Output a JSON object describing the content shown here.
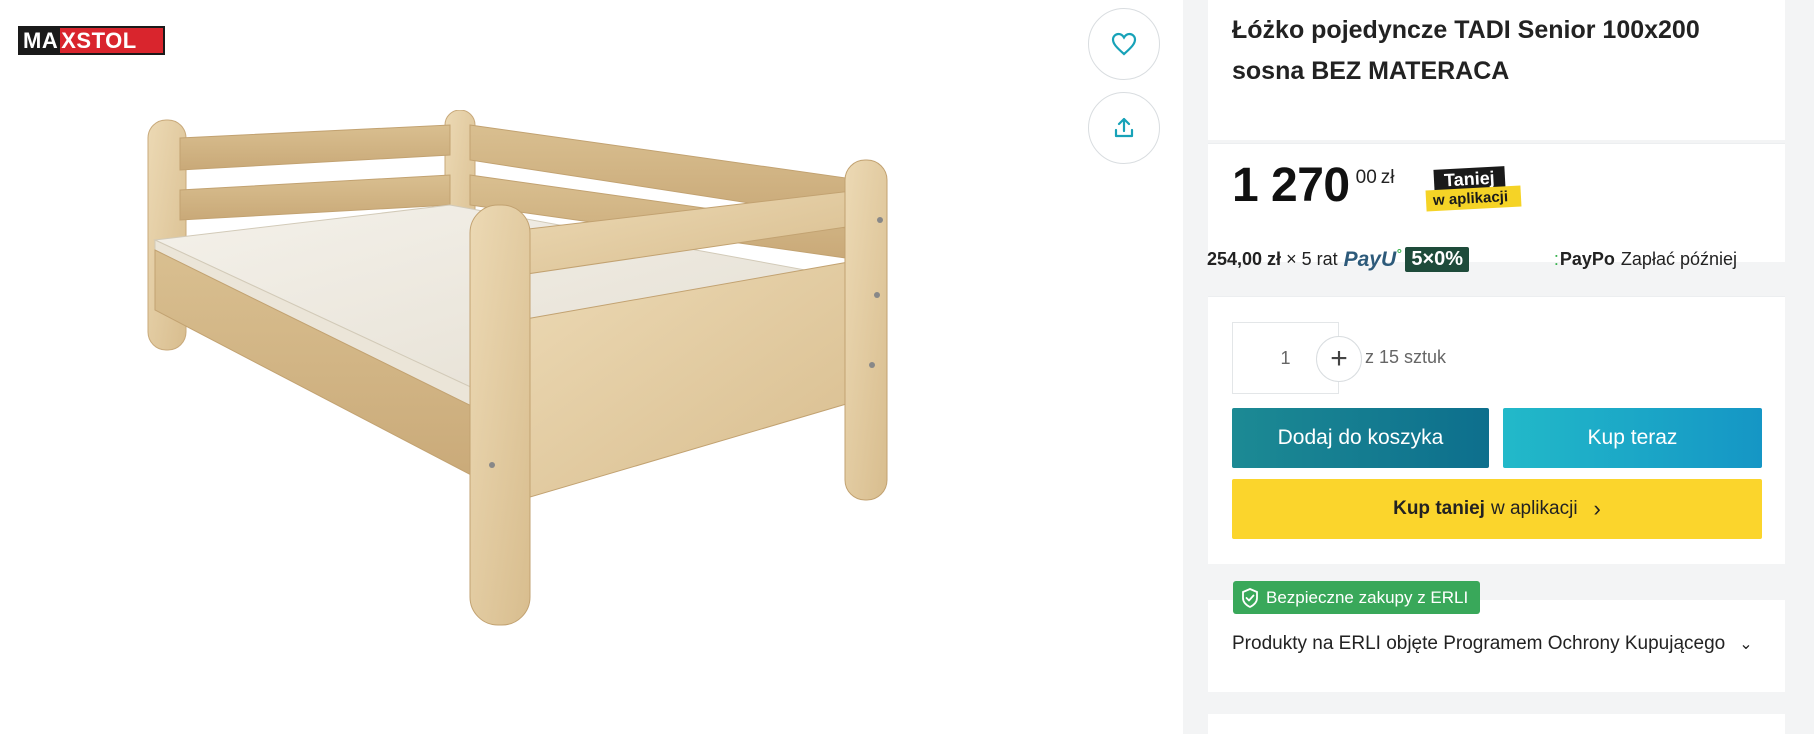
{
  "logo": {
    "part1": "MA",
    "part2": "XSTOL"
  },
  "gallery": {
    "favorite_icon": "heart-icon",
    "share_icon": "share-icon"
  },
  "product": {
    "title_line1": "Łóżko pojedyncze TADI Senior 100x200",
    "title_line2": "sosna BEZ MATERACA"
  },
  "price": {
    "integer": "1 270",
    "decimal": "00",
    "currency": "zł"
  },
  "app_badge": {
    "line1": "Taniej",
    "line2": "w aplikacji"
  },
  "installments": {
    "amount": "254,00 zł",
    "times": "×",
    "count": "5 rat",
    "payu_label": "PayU",
    "promo": "5×0%",
    "paypo_label": "PayPo",
    "paypo_text": "Zapłać później"
  },
  "quantity": {
    "value": "1",
    "plus": "+",
    "stock": "z 15 sztuk"
  },
  "buttons": {
    "add_to_cart": "Dodaj do koszyka",
    "buy_now": "Kup teraz",
    "app_bold": "Kup taniej",
    "app_rest": "w aplikacji",
    "app_chevron": "›"
  },
  "safety": {
    "badge": "Bezpieczne zakupy z ERLI",
    "text": "Produkty na ERLI objęte Programem Ochrony Kupującego",
    "chevron": "⌄"
  },
  "colors": {
    "accent_teal": "#0d6f8d",
    "accent_cyan": "#22b9c9",
    "yellow": "#fbd52c",
    "green": "#39a85a",
    "payu_green_bg": "#1e4b3a",
    "logo_red": "#d9252d"
  }
}
